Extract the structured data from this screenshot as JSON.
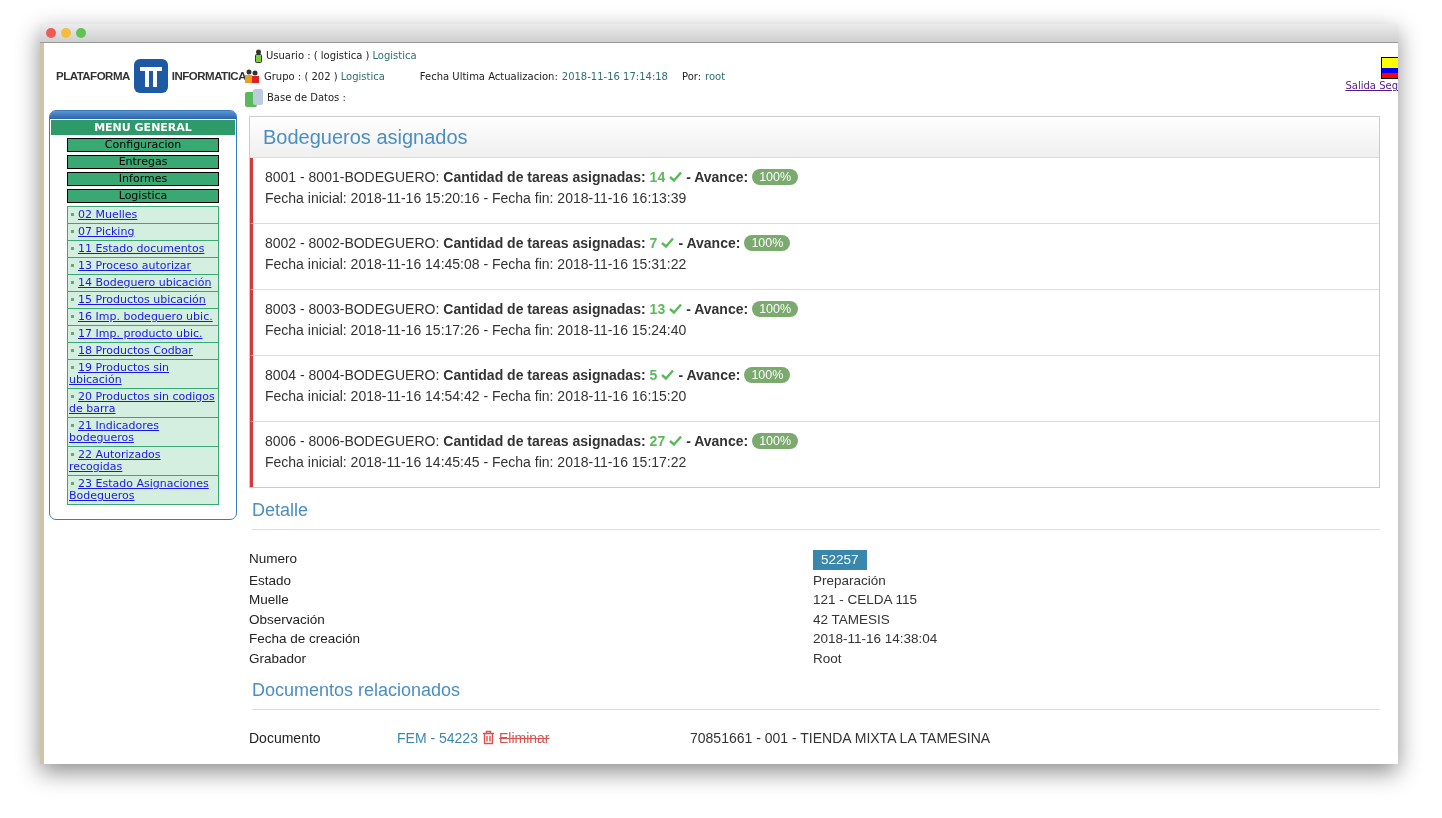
{
  "header": {
    "logo": {
      "left": "PLATAFORMA",
      "right": "INFORMATICA"
    },
    "user": {
      "label": "Usuario : ( logistica )",
      "value": "Logistica"
    },
    "group": {
      "label": "Grupo : ( 202 )",
      "value": "Logistica"
    },
    "updated": {
      "label": "Fecha Ultima Actualizacion:",
      "value": "2018-11-16 17:14:18",
      "by_label": "Por:",
      "by_value": "root"
    },
    "database": {
      "label": "Base de Datos :"
    },
    "exit_link": "Salida Seg"
  },
  "menu": {
    "title": "MENU GENERAL",
    "sections": [
      {
        "label": "Configuracion"
      },
      {
        "label": "Entregas"
      },
      {
        "label": "Informes"
      },
      {
        "label": "Logistica",
        "items": [
          "02 Muelles",
          "07 Picking",
          "11 Estado documentos",
          "13 Proceso autorizar",
          "14 Bodeguero ubicación",
          "15 Productos ubicación",
          "16 Imp. bodeguero ubic.",
          "17 Imp. producto ubic.",
          "18 Productos Codbar",
          "19 Productos sin ubicación",
          "20 Productos sin codigos de barra",
          "21 Indicadores bodegueros",
          "22 Autorizados recogidas",
          "23 Estado Asignaciones Bodegueros"
        ]
      }
    ]
  },
  "assignments": {
    "title": "Bodegueros asignados",
    "rows": [
      {
        "worker": "8001 - 8001-BODEGUERO:",
        "count_label": "Cantidad de tareas asignadas:",
        "count": "14",
        "progress_label": "- Avance:",
        "badge": "100%",
        "dates": "Fecha inicial: 2018-11-16 15:20:16 - Fecha fin: 2018-11-16 16:13:39"
      },
      {
        "worker": "8002 - 8002-BODEGUERO:",
        "count_label": "Cantidad de tareas asignadas:",
        "count": "7",
        "progress_label": "- Avance:",
        "badge": "100%",
        "dates": "Fecha inicial: 2018-11-16 14:45:08 - Fecha fin: 2018-11-16 15:31:22"
      },
      {
        "worker": "8003 - 8003-BODEGUERO:",
        "count_label": "Cantidad de tareas asignadas:",
        "count": "13",
        "progress_label": "- Avance:",
        "badge": "100%",
        "dates": "Fecha inicial: 2018-11-16 15:17:26 - Fecha fin: 2018-11-16 15:24:40"
      },
      {
        "worker": "8004 - 8004-BODEGUERO:",
        "count_label": "Cantidad de tareas asignadas:",
        "count": "5",
        "progress_label": "- Avance:",
        "badge": "100%",
        "dates": "Fecha inicial: 2018-11-16 14:54:42 - Fecha fin: 2018-11-16 16:15:20"
      },
      {
        "worker": "8006 - 8006-BODEGUERO:",
        "count_label": "Cantidad de tareas asignadas:",
        "count": "27",
        "progress_label": "- Avance:",
        "badge": "100%",
        "dates": "Fecha inicial: 2018-11-16 14:45:45 - Fecha fin: 2018-11-16 15:17:22"
      }
    ]
  },
  "detail": {
    "title": "Detalle",
    "fields": [
      {
        "label": "Numero",
        "value": "52257",
        "kind": "badge"
      },
      {
        "label": "Estado",
        "value": "Preparación",
        "kind": "text"
      },
      {
        "label": "Muelle",
        "value": "121 - CELDA 115",
        "kind": "text"
      },
      {
        "label": "Observación",
        "value": "42 TAMESIS",
        "kind": "text"
      },
      {
        "label": "Fecha de creación",
        "value": "2018-11-16 14:38:04",
        "kind": "text"
      },
      {
        "label": "Grabador",
        "value": "Root",
        "kind": "text"
      }
    ]
  },
  "documents": {
    "title": "Documentos relacionados",
    "rows": [
      {
        "label": "Documento",
        "document": "FEM - 54223",
        "action": "Eliminar",
        "customer": "70851661 - 001 - TIENDA MIXTA LA TAMESINA"
      }
    ]
  }
}
